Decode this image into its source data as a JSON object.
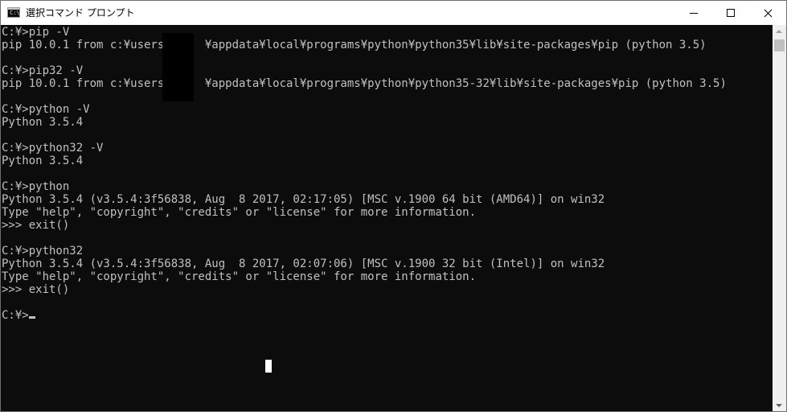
{
  "window": {
    "title": "選択コマンド プロンプト",
    "icon": "command-prompt-icon",
    "icon_text": "C:\\",
    "controls": {
      "minimize": "minimize-icon",
      "maximize": "maximize-icon",
      "close": "close-icon"
    }
  },
  "console": {
    "lines": [
      "C:¥>pip -V",
      "pip 10.0.1 from c:¥users¥     ¥appdata¥local¥programs¥python¥python35¥lib¥site-packages¥pip (python 3.5)",
      "",
      "C:¥>pip32 -V",
      "pip 10.0.1 from c:¥users¥     ¥appdata¥local¥programs¥python¥python35-32¥lib¥site-packages¥pip (python 3.5)",
      "",
      "C:¥>python -V",
      "Python 3.5.4",
      "",
      "C:¥>python32 -V",
      "Python 3.5.4",
      "",
      "C:¥>python",
      "Python 3.5.4 (v3.5.4:3f56838, Aug  8 2017, 02:17:05) [MSC v.1900 64 bit (AMD64)] on win32",
      "Type \"help\", \"copyright\", \"credits\" or \"license\" for more information.",
      ">>> exit()",
      "",
      "C:¥>python32",
      "Python 3.5.4 (v3.5.4:3f56838, Aug  8 2017, 02:07:06) [MSC v.1900 32 bit (Intel)] on win32",
      "Type \"help\", \"copyright\", \"credits\" or \"license\" for more information.",
      ">>> exit()",
      "",
      "C:¥>"
    ]
  },
  "colors": {
    "console_background": "#0c0c0c",
    "console_text": "#c0c0c0",
    "titlebar_background": "#ffffff"
  }
}
